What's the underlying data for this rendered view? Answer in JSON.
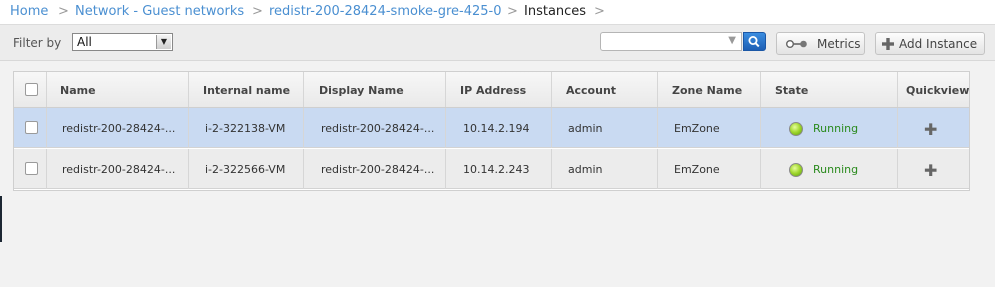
{
  "breadcrumb": {
    "items": [
      {
        "label": "Home"
      },
      {
        "label": "Network - Guest networks"
      },
      {
        "label": "redistr-200-28424-smoke-gre-425-0"
      },
      {
        "label": "Instances"
      }
    ],
    "separator": ">"
  },
  "toolbar": {
    "filter_label": "Filter by",
    "filter_value": "All",
    "search_value": "",
    "metrics_label": "Metrics",
    "add_label": "Add Instance"
  },
  "table": {
    "columns": [
      "Name",
      "Internal name",
      "Display Name",
      "IP Address",
      "Account",
      "Zone Name",
      "State",
      "Quickview"
    ],
    "rows": [
      {
        "name": "redistr-200-28424-...",
        "internal_name": "i-2-322138-VM",
        "display_name": "redistr-200-28424-...",
        "ip": "10.14.2.194",
        "account": "admin",
        "zone": "EmZone",
        "state": "Running",
        "selected": true
      },
      {
        "name": "redistr-200-28424-...",
        "internal_name": "i-2-322566-VM",
        "display_name": "redistr-200-28424-...",
        "ip": "10.14.2.243",
        "account": "admin",
        "zone": "EmZone",
        "state": "Running",
        "selected": false
      }
    ]
  },
  "icons": {
    "search": "magnifier-icon",
    "metrics": "metrics-icon",
    "add": "plus-icon",
    "state": "running-indicator-icon",
    "quickview": "quickview-plus-icon"
  },
  "colors": {
    "link": "#4a8fd1",
    "selected_row": "#c9daf2",
    "running": "#2a8a1d",
    "search_button": "#1d5fb4"
  }
}
